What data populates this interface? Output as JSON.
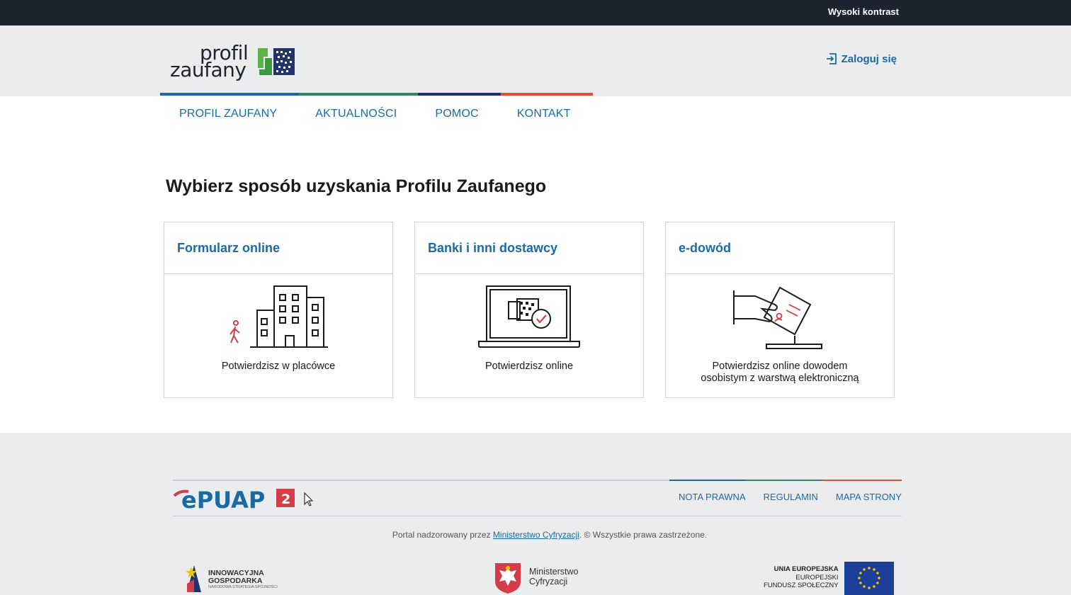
{
  "topbar": {
    "contrast_label": "Wysoki kontrast"
  },
  "header": {
    "logo_line1": "profil",
    "logo_line2": "zaufany",
    "login_label": "Zaloguj się"
  },
  "nav": {
    "items": [
      {
        "label": "PROFIL ZAUFANY"
      },
      {
        "label": "AKTUALNOŚCI"
      },
      {
        "label": "POMOC"
      },
      {
        "label": "KONTAKT"
      }
    ]
  },
  "main": {
    "heading": "Wybierz sposób uzyskania Profilu Zaufanego",
    "cards": [
      {
        "title": "Formularz online",
        "description": "Potwierdzisz w placówce",
        "icon": "building-icon"
      },
      {
        "title": "Banki i inni dostawcy",
        "description": "Potwierdzisz online",
        "icon": "laptop-icon"
      },
      {
        "title": "e-dowód",
        "description_line1": "Potwierdzisz online dowodem",
        "description_line2": "osobistym z warstwą elektroniczną",
        "icon": "id-card-icon"
      }
    ]
  },
  "footer": {
    "epuap_badge": "2",
    "links": [
      {
        "label": "NOTA PRAWNA"
      },
      {
        "label": "REGULAMIN"
      },
      {
        "label": "MAPA STRONY"
      }
    ],
    "copyright_prefix": "Portal nadzorowany przez",
    "copyright_link": "Ministerstwo Cyfryzacji",
    "copyright_suffix": ". © Wszystkie prawa zastrzeżone.",
    "inno_line1": "INNOWACYJNA",
    "inno_line2": "GOSPODARKA",
    "inno_sub": "NARODOWA STRATEGIA SPÓJNOŚCI",
    "ministry_line1": "Ministerstwo",
    "ministry_line2": "Cyfryzacji",
    "ue_line1": "UNIA EUROPEJSKA",
    "ue_line2": "EUROPEJSKI",
    "ue_line3": "FUNDUSZ SPOŁECZNY"
  },
  "colors": {
    "dark_bar": "#1e2330",
    "accent_blue": "#1a6aa6",
    "stripe": [
      "#1a6aa6",
      "#2b8a6a",
      "#22346b",
      "#e0522d"
    ]
  }
}
